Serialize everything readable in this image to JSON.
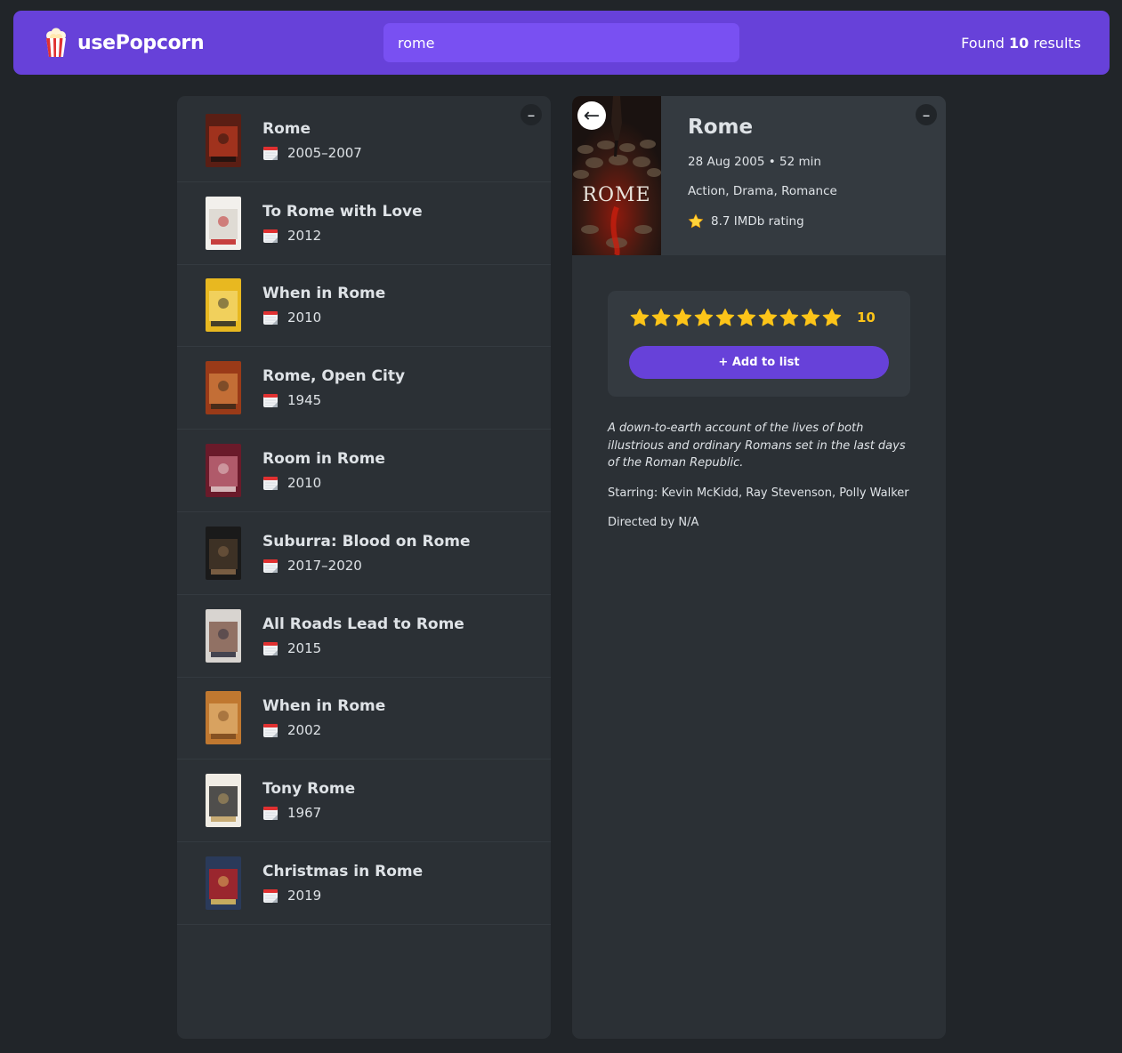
{
  "nav": {
    "logo_text": "usePopcorn",
    "logo_icon": "popcorn-icon",
    "search_value": "rome",
    "found_prefix": "Found",
    "found_count": "10",
    "found_suffix": "results"
  },
  "list": {
    "toggle_label": "–",
    "items": [
      {
        "title": "Rome",
        "year": "2005–2007"
      },
      {
        "title": "To Rome with Love",
        "year": "2012"
      },
      {
        "title": "When in Rome",
        "year": "2010"
      },
      {
        "title": "Rome, Open City",
        "year": "1945"
      },
      {
        "title": "Room in Rome",
        "year": "2010"
      },
      {
        "title": "Suburra: Blood on Rome",
        "year": "2017–2020"
      },
      {
        "title": "All Roads Lead to Rome",
        "year": "2015"
      },
      {
        "title": "When in Rome",
        "year": "2002"
      },
      {
        "title": "Tony Rome",
        "year": "1967"
      },
      {
        "title": "Christmas in Rome",
        "year": "2019"
      }
    ]
  },
  "detail": {
    "toggle_label": "–",
    "back_label": "←",
    "title": "Rome",
    "poster_text": "ROME",
    "released_runtime": "28 Aug 2005 • 52 min",
    "genres": "Action, Drama, Romance",
    "imdb_rating": "8.7 IMDb rating",
    "user_rating": "10",
    "star_count": 10,
    "add_button": "+ Add to list",
    "plot": "A down-to-earth account of the lives of both illustrious and ordinary Romans set in the last days of the Roman Republic.",
    "starring": "Starring: Kevin McKidd, Ray Stevenson, Polly Walker",
    "directed": "Directed by N/A"
  },
  "colors": {
    "nav_bg": "#6741d9",
    "search_bg": "#7950f2",
    "page_bg": "#212529",
    "box_bg": "#2b3035",
    "star": "#fcc419"
  }
}
